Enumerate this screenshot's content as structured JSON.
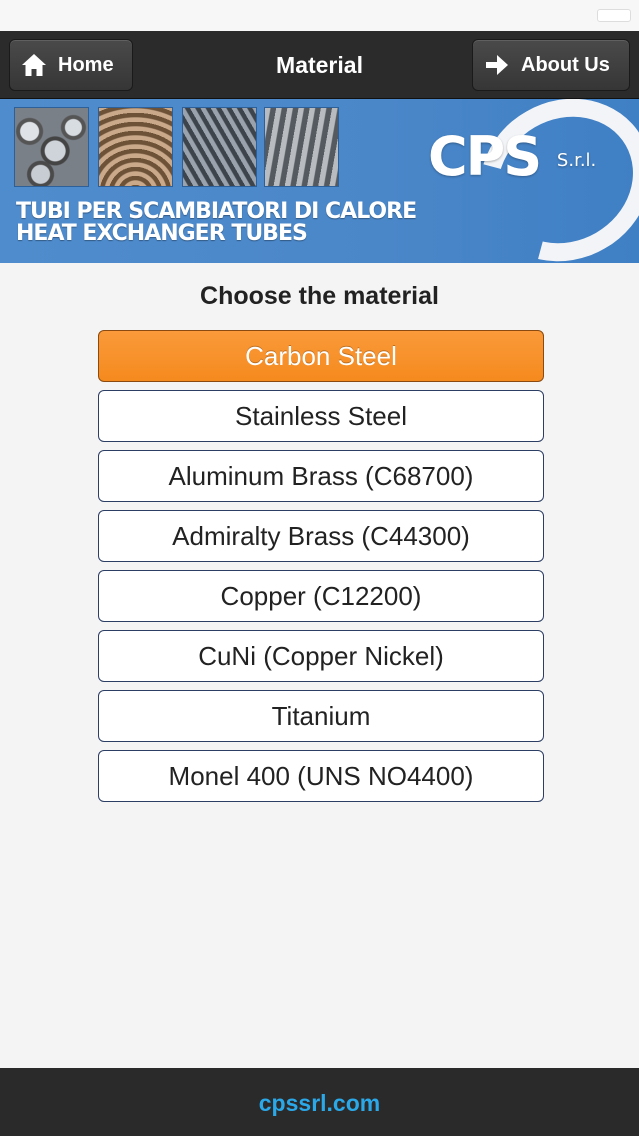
{
  "nav": {
    "home_label": "Home",
    "title": "Material",
    "about_label": "About Us"
  },
  "banner": {
    "logo_text": "CPS",
    "logo_suffix": "S.r.l.",
    "subtitle_it": "TUBI PER SCAMBIATORI DI CALORE",
    "subtitle_en": "HEAT EXCHANGER TUBES"
  },
  "main": {
    "heading": "Choose the material",
    "materials": [
      {
        "label": "Carbon Steel",
        "selected": true
      },
      {
        "label": "Stainless Steel",
        "selected": false
      },
      {
        "label": "Aluminum Brass (C68700)",
        "selected": false
      },
      {
        "label": "Admiralty Brass (C44300)",
        "selected": false
      },
      {
        "label": "Copper (C12200)",
        "selected": false
      },
      {
        "label": "CuNi (Copper Nickel)",
        "selected": false
      },
      {
        "label": "Titanium",
        "selected": false
      },
      {
        "label": "Monel 400 (UNS NO4400)",
        "selected": false
      }
    ]
  },
  "footer": {
    "link": "cpssrl.com"
  },
  "colors": {
    "header_bg": "#2b2b2b",
    "accent_orange": "#f58a1e",
    "footer_link": "#2aa8e8",
    "banner_blue": "#4a87c9"
  },
  "icons": {
    "home": "home-icon",
    "about": "arrow-right-icon"
  }
}
